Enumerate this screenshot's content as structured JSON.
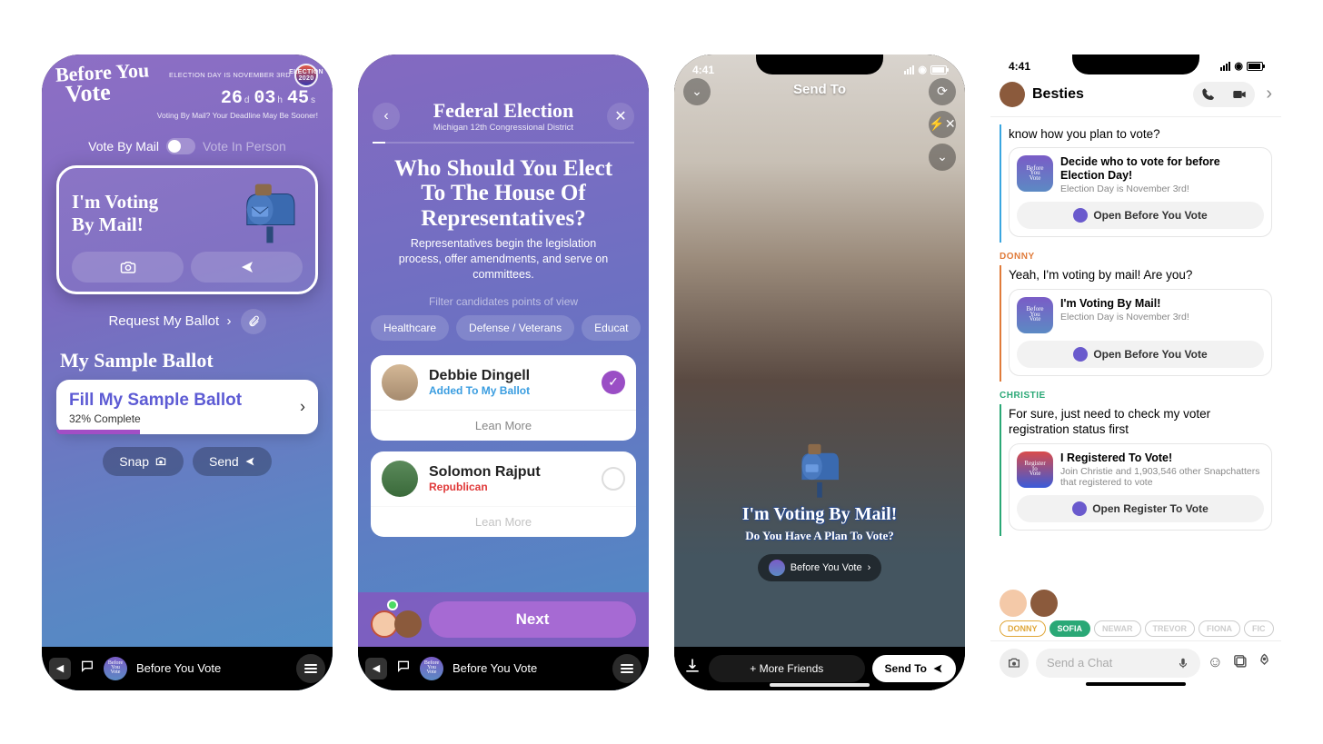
{
  "phone1": {
    "app_logo": {
      "line1": "Before You",
      "line2": "Vote"
    },
    "countdown_label": "ELECTION DAY IS NOVEMBER 3RD",
    "countdown": {
      "d": "26",
      "h": "03",
      "m": "45",
      "d_unit": "d",
      "h_unit": "h",
      "m_unit": "s"
    },
    "badge_2020": "2020",
    "deadline_warning": "Voting By Mail? Your Deadline May Be Sooner!",
    "toggle": {
      "left": "Vote By Mail",
      "right": "Vote In Person"
    },
    "mail_card": {
      "line1": "I'm Voting",
      "line2": "By Mail!"
    },
    "request_ballot": "Request My Ballot",
    "section_title": "My Sample Ballot",
    "fill_card": {
      "title": "Fill My Sample Ballot",
      "pct": "32% Complete",
      "progress": 32
    },
    "snap_btn": "Snap",
    "send_btn": "Send",
    "appbar_name": "Before You Vote"
  },
  "phone2": {
    "title": "Federal Election",
    "subtitle": "Michigan 12th Congressional District",
    "question": "Who Should You Elect To The House Of Representatives?",
    "description": "Representatives begin the legislation process, offer amendments, and serve on committees.",
    "filter_label": "Filter candidates points of view",
    "chips": [
      "Healthcare",
      "Defense / Veterans",
      "Educat"
    ],
    "candidates": [
      {
        "name": "Debbie Dingell",
        "sub": "Added To My Ballot",
        "sub_color": "#3a9de0",
        "checked": true,
        "learn": "Lean More"
      },
      {
        "name": "Solomon Rajput",
        "sub": "Republican",
        "sub_color": "#e03a3a",
        "checked": false,
        "learn": "Lean More"
      }
    ],
    "next": "Next",
    "appbar_name": "Before You Vote"
  },
  "phone3": {
    "time": "4:41",
    "send_to_title": "Send To",
    "sticker_line1": "I'm Voting By Mail!",
    "sticker_line2": "Do You Have A Plan To Vote?",
    "byv_pill": "Before You Vote",
    "more_friends": "+ More Friends",
    "send_to_btn": "Send To"
  },
  "phone4": {
    "time": "4:41",
    "header": "Besties",
    "prev_msg": "know how you plan to vote?",
    "cards": [
      {
        "sender": null,
        "border": "#3aa6e0",
        "title": "Decide who to vote for before Election Day!",
        "sub": "Election Day is November 3rd!",
        "open": "Open Before You Vote",
        "icon": "byv"
      },
      {
        "sender": "DONNY",
        "sender_color": "#e07b3a",
        "border": "#e07b3a",
        "text": "Yeah, I'm voting by mail! Are you?",
        "title": "I'm Voting By Mail!",
        "sub": "Election Day is November 3rd!",
        "open": "Open Before You Vote",
        "icon": "byv"
      },
      {
        "sender": "CHRISTIE",
        "sender_color": "#2aa876",
        "border": "#2aa876",
        "text": "For sure, just need to check my voter registration status first",
        "title": "I Registered To Vote!",
        "sub": "Join Christie and 1,903,546 other Snapchatters that registered to vote",
        "open": "Open Register To Vote",
        "icon": "reg"
      }
    ],
    "friend_chips": [
      {
        "name": "DONNY",
        "color": "#e0a73a"
      },
      {
        "name": "SOFIA",
        "color": "#2aa876",
        "filled": true
      },
      {
        "name": "NEWAR",
        "color": "#ccc"
      },
      {
        "name": "TREVOR",
        "color": "#ccc"
      },
      {
        "name": "FIONA",
        "color": "#ccc"
      },
      {
        "name": "FIC",
        "color": "#ccc"
      }
    ],
    "input_placeholder": "Send a Chat"
  }
}
